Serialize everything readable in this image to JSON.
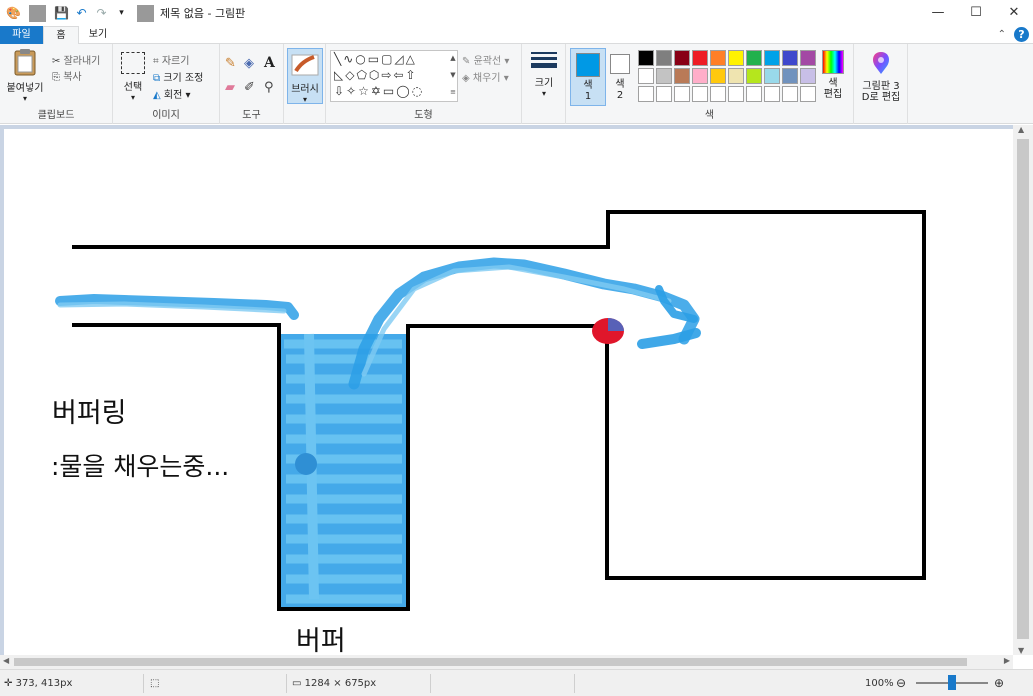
{
  "window": {
    "title": "제목 없음 - 그림판",
    "quick_access": [
      "paint-app-icon",
      "save-icon",
      "undo-icon",
      "redo-icon",
      "customize-dropdown-icon"
    ],
    "controls": [
      "minimize",
      "maximize",
      "close"
    ]
  },
  "tabs": [
    {
      "label": "파일"
    },
    {
      "label": "홈",
      "selected": true
    },
    {
      "label": "보기"
    }
  ],
  "ribbon": {
    "clipboard": {
      "label": "클립보드",
      "paste": "붙여넣기",
      "cut": "잘라내기",
      "copy": "복사"
    },
    "image": {
      "label": "이미지",
      "select": "선택",
      "crop": "자르기",
      "resize": "크기 조정",
      "rotate": "회전"
    },
    "tools": {
      "label": "도구"
    },
    "brushes": {
      "label": "브러시"
    },
    "shapes": {
      "label": "도형",
      "outline": "윤곽선",
      "fill": "채우기"
    },
    "size": {
      "label": "크기"
    },
    "colors": {
      "label": "색",
      "color1": "색\n1",
      "color2": "색\n2",
      "color1_value": "#0099e5",
      "color2_value": "#ffffff",
      "edit_colors": "색\n편집",
      "palette": [
        "#000000",
        "#7f7f7f",
        "#880015",
        "#ed1c24",
        "#ff7f27",
        "#fff200",
        "#22b14c",
        "#00a2e8",
        "#3f48cc",
        "#a349a4",
        "#ffffff",
        "#c3c3c3",
        "#b97a57",
        "#ffaec9",
        "#ffc90e",
        "#efe4b0",
        "#b5e61d",
        "#99d9ea",
        "#7092be",
        "#c8bfe7",
        "#ffffff",
        "#ffffff",
        "#ffffff",
        "#ffffff",
        "#ffffff",
        "#ffffff",
        "#ffffff",
        "#ffffff",
        "#ffffff",
        "#ffffff"
      ]
    },
    "paint3d": "그림판 3\nD로 편집"
  },
  "canvas": {
    "buffering_text": "버퍼링",
    "filling_text": ":물을 채우는중...",
    "buffer_label": "버퍼",
    "stroke_color": "#000000",
    "water_color": "#2b9fe6",
    "marker_colors": [
      "#e0162b",
      "#3f6fd0"
    ]
  },
  "status": {
    "cursor_pos": "373, 413px",
    "canvas_size": "1284 × 675px",
    "zoom": "100%",
    "zoom_level": 0.5
  }
}
